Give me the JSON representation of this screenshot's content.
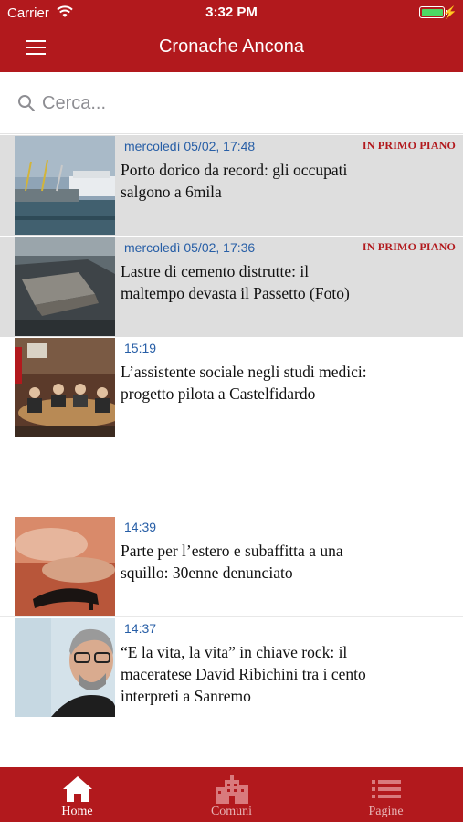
{
  "status_bar": {
    "carrier": "Carrier",
    "time": "3:32 PM",
    "battery_level": 1.0
  },
  "header": {
    "title": "Cronache Ancona",
    "menu_icon": "hamburger-icon"
  },
  "search": {
    "placeholder": "Cerca..."
  },
  "articles": [
    {
      "date": "mercoledì 05/02, 17:48",
      "badge": "IN PRIMO PIANO",
      "title": "Porto dorico da record:  gli occupati\nsalgono a 6mila",
      "highlighted": true
    },
    {
      "date": "mercoledì 05/02, 17:36",
      "badge": "IN PRIMO PIANO",
      "title": "Lastre di cemento distrutte:  il\nmaltempo devasta il Passetto   (Foto)",
      "highlighted": true
    },
    {
      "date": "15:19",
      "badge": "",
      "title": "L’assistente sociale negli studi medici:\nprogetto pilota a Castelfidardo",
      "highlighted": false
    },
    {
      "date": "14:39",
      "badge": "",
      "title": "Parte per l’estero e subaffitta  a una\nsquillo: 30enne denunciato",
      "highlighted": false
    },
    {
      "date": "14:37",
      "badge": "",
      "title": "“E la vita, la vita” in chiave rock:  il\nmaceratese David Ribichini  tra i cento\ninterpreti a Sanremo",
      "highlighted": false
    }
  ],
  "tabs": [
    {
      "label": "Home",
      "icon": "home-icon",
      "active": true
    },
    {
      "label": "Comuni",
      "icon": "building-icon",
      "active": false
    },
    {
      "label": "Pagine",
      "icon": "list-icon",
      "active": false
    }
  ],
  "colors": {
    "brand_red": "#b2191d",
    "date_blue": "#275ea6",
    "highlight_gray": "#dedede"
  }
}
